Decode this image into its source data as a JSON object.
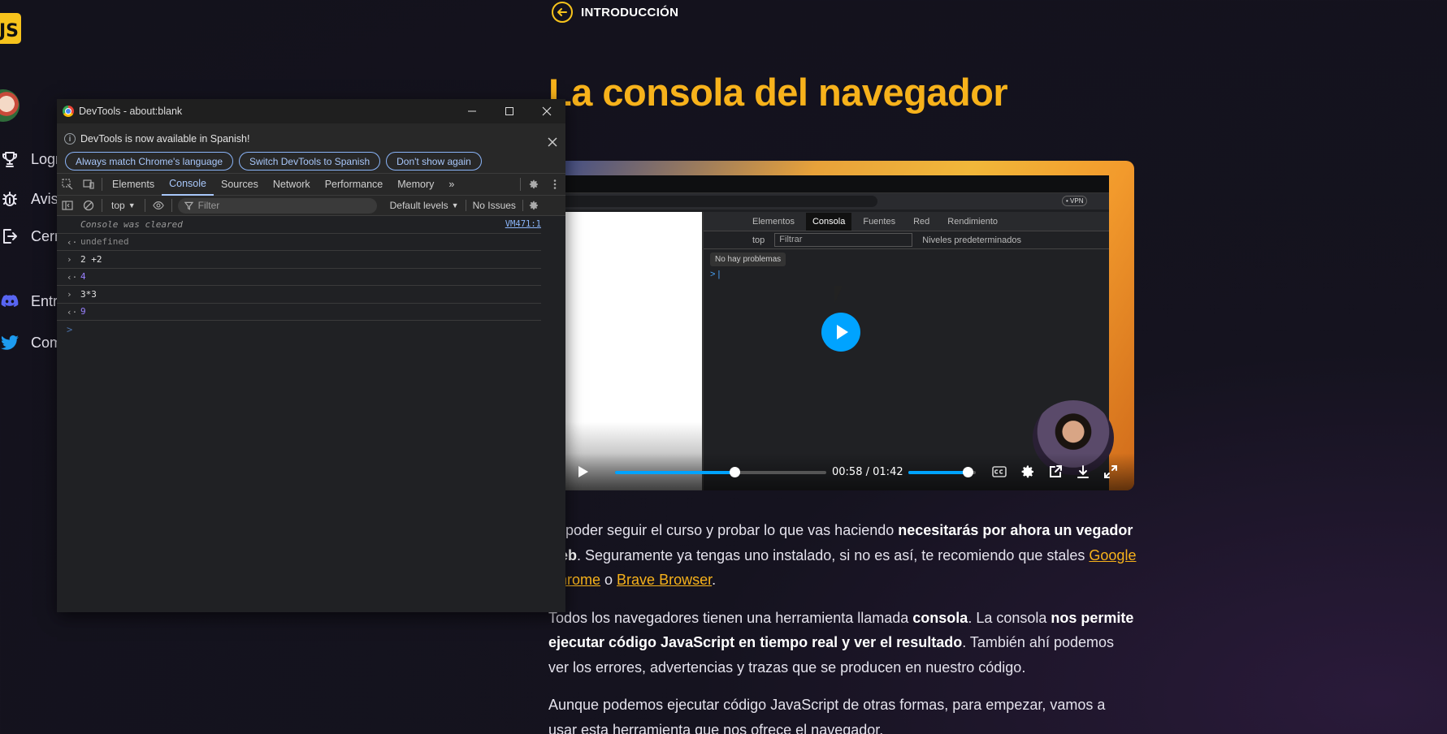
{
  "sidebar": {
    "logo": "JS",
    "items": [
      {
        "label": "Logr"
      },
      {
        "label": "Avis"
      },
      {
        "label": "Cerra"
      },
      {
        "label": "Entr"
      },
      {
        "label": "Com"
      }
    ]
  },
  "breadcrumb": {
    "label": "INTRODUCCIÓN"
  },
  "page": {
    "title": "La consola del navegador"
  },
  "video": {
    "current_time": "00:58",
    "separator": "/",
    "duration": "01:42",
    "progress": 0.567,
    "volume": 0.88,
    "inner": {
      "vpn": "• VPN",
      "tabs": [
        "Elementos",
        "Consola",
        "Fuentes",
        "Red",
        "Rendimiento"
      ],
      "active_tab": "Consola",
      "context": "top",
      "filter_placeholder": "Filtrar",
      "levels": "Niveles predeterminados",
      "issues": "No hay problemas"
    }
  },
  "article": {
    "p1": {
      "t1": "ra poder seguir el curso y probar lo que vas haciendo ",
      "b1": "necesitarás por ahora un vegador web",
      "t2": ". Seguramente ya tengas uno instalado, si no es así, te recomiendo que stales ",
      "link1": "Google Chrome",
      "t3": " o ",
      "link2": "Brave Browser",
      "t4": "."
    },
    "p2": {
      "t1": "Todos los navegadores tienen una herramienta llamada ",
      "b1": "consola",
      "t2": ". La consola ",
      "b2": "nos permite ejecutar código JavaScript en tiempo real y ver el resultado",
      "t3": ". También ahí podemos ver los errores, advertencias y trazas que se producen en nuestro código."
    },
    "p3": "Aunque podemos ejecutar código JavaScript de otras formas, para empezar, vamos a usar esta herramienta que nos ofrece el navegador."
  },
  "devtools": {
    "window_title": "DevTools - about:blank",
    "infobar": {
      "message": "DevTools is now available in Spanish!",
      "buttons": [
        "Always match Chrome's language",
        "Switch DevTools to Spanish",
        "Don't show again"
      ]
    },
    "tabs": [
      "Elements",
      "Console",
      "Sources",
      "Network",
      "Performance",
      "Memory"
    ],
    "active_tab": "Console",
    "more_tabs": "»",
    "context": "top",
    "filter_placeholder": "Filter",
    "levels": "Default levels",
    "issues": "No Issues",
    "console": [
      {
        "type": "cleared",
        "text": "Console was cleared",
        "source": "VM471:1"
      },
      {
        "type": "result",
        "text": "undefined"
      },
      {
        "type": "input",
        "text": "2 +2"
      },
      {
        "type": "result-num",
        "text": "4"
      },
      {
        "type": "input",
        "text": "3*3"
      },
      {
        "type": "result-num",
        "text": "9"
      }
    ],
    "prompt": ">"
  },
  "colors": {
    "accent": "#f7b21b",
    "video_blue": "#00a3ff",
    "devtools_bg": "#202124",
    "link_blue": "#8ab4f8"
  }
}
